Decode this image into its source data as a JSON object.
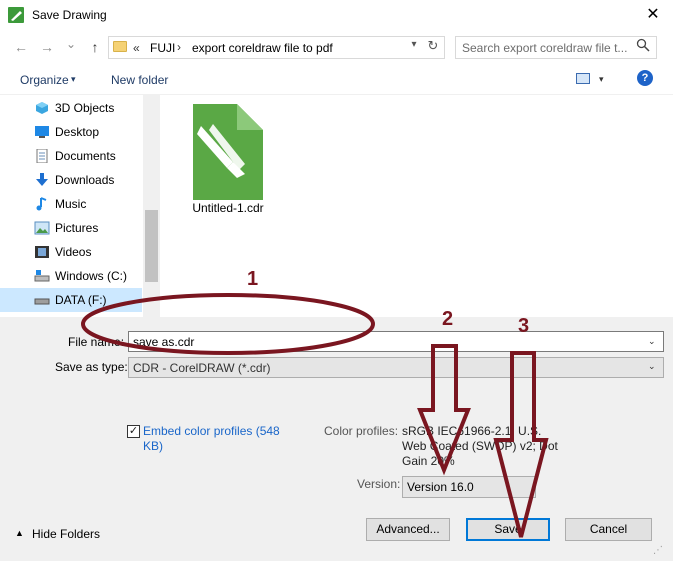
{
  "window": {
    "title": "Save Drawing",
    "close_glyph": "✕"
  },
  "nav": {
    "back_glyph": "←",
    "forward_glyph": "→",
    "dropdown_glyph": "⌄",
    "up_glyph": "↑",
    "breadcrumb": {
      "overflow": "«",
      "sep": "›",
      "items": [
        "FUJI",
        "export coreldraw file to pdf"
      ]
    },
    "addr_drop_glyph": "▾",
    "refresh_glyph": "↻",
    "search_placeholder": "Search export coreldraw file t..."
  },
  "toolbar": {
    "organize": "Organize",
    "caret": "▾",
    "new_folder": "New folder",
    "view_caret": "▾",
    "help": "?"
  },
  "sidebar": {
    "items": [
      {
        "label": "3D Objects",
        "icon": "cube-icon"
      },
      {
        "label": "Desktop",
        "icon": "desktop-icon"
      },
      {
        "label": "Documents",
        "icon": "documents-icon"
      },
      {
        "label": "Downloads",
        "icon": "download-icon"
      },
      {
        "label": "Music",
        "icon": "music-icon"
      },
      {
        "label": "Pictures",
        "icon": "pictures-icon"
      },
      {
        "label": "Videos",
        "icon": "videos-icon"
      },
      {
        "label": "Windows (C:)",
        "icon": "drive-icon"
      },
      {
        "label": "DATA (F:)",
        "icon": "drive-icon",
        "selected": true
      }
    ]
  },
  "files": [
    {
      "name": "Untitled-1.cdr",
      "icon": "coreldraw-file-icon"
    }
  ],
  "form": {
    "file_name_label": "File name:",
    "file_name_value": "save as.cdr",
    "save_type_label": "Save as type:",
    "save_type_value": "CDR - CorelDRAW (*.cdr)",
    "drop_glyph": "⌄",
    "embed_checked": "✓",
    "embed_label": "Embed color profiles (548 KB)",
    "color_profiles_label": "Color profiles:",
    "color_profiles_value": "sRGB IEC61966-2.1; U.S. Web Coated (SWOP) v2; Dot Gain 20%",
    "version_label": "Version:",
    "version_value": "Version 16.0",
    "advanced_button": "Advanced...",
    "save_button": "Save",
    "cancel_button": "Cancel",
    "hide_caret": "▲",
    "hide_folders": "Hide Folders",
    "grip_glyph": "⋰"
  },
  "annotations": {
    "one": "1",
    "two": "2",
    "three": "3",
    "color": "#7a1620"
  }
}
